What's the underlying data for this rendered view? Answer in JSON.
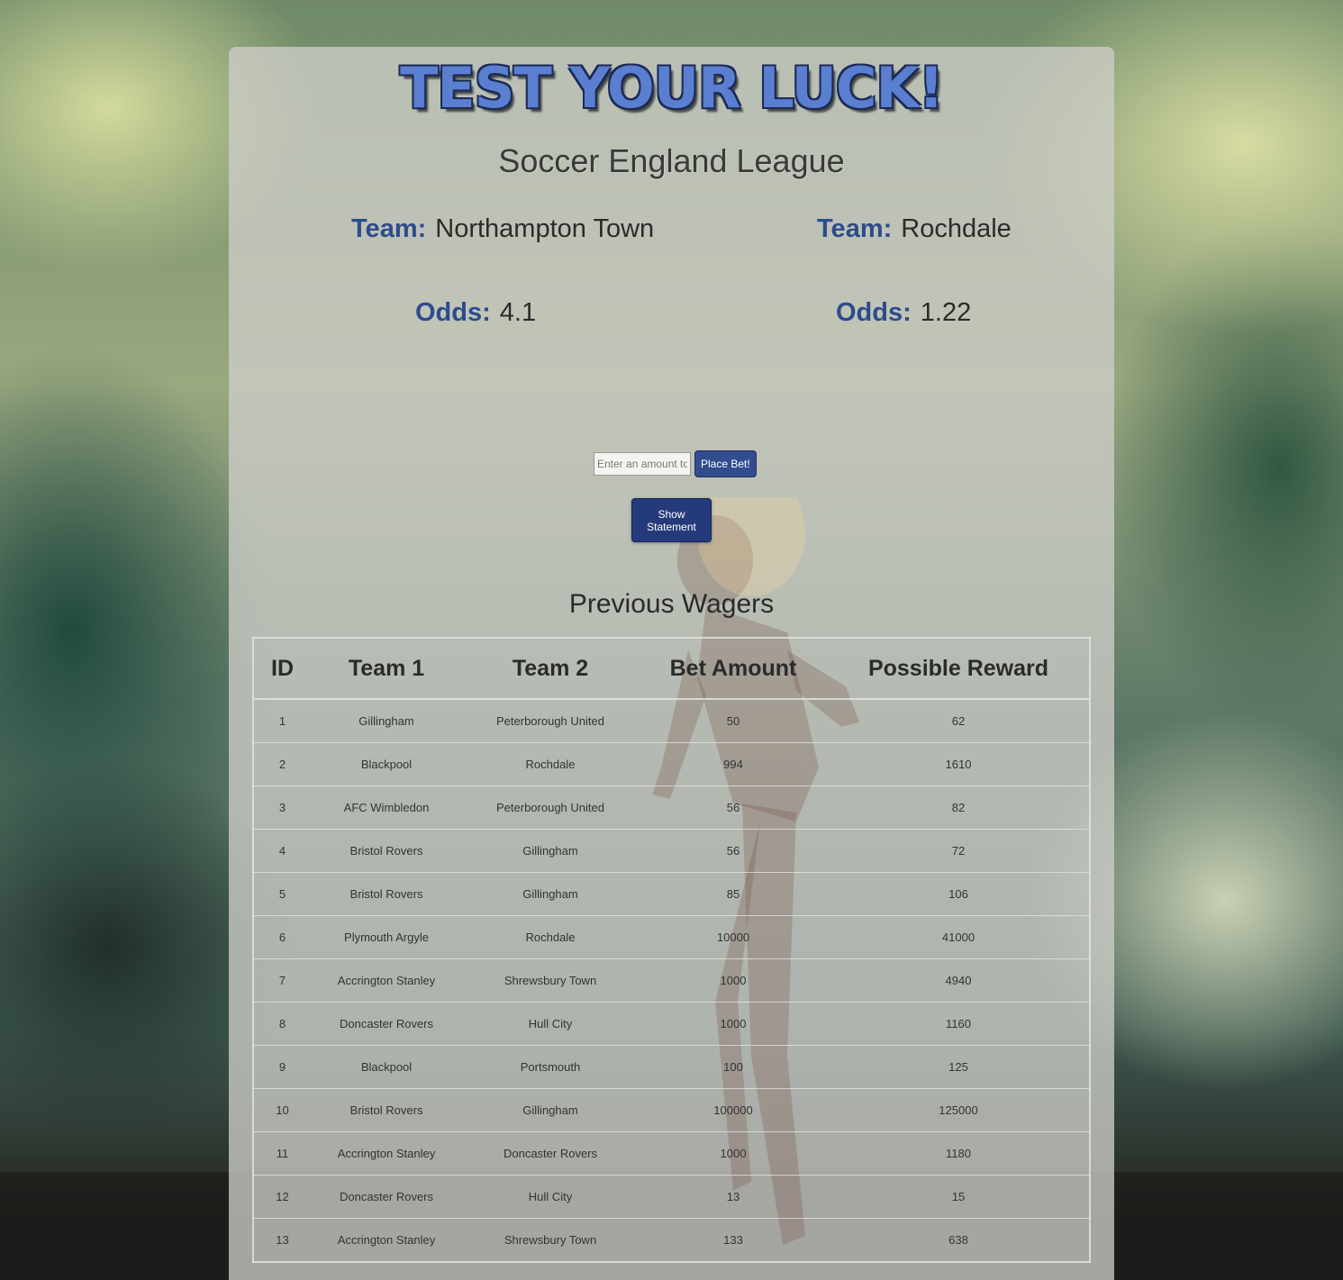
{
  "header": {
    "logo_text": "Test Your Luck!",
    "league_title": "Soccer England League"
  },
  "match": {
    "team_label": "Team:",
    "odds_label": "Odds:",
    "team1": {
      "name": "Northampton Town",
      "odds": "4.1"
    },
    "team2": {
      "name": "Rochdale",
      "odds": "1.22"
    }
  },
  "bet_form": {
    "amount_placeholder": "Enter an amount to place",
    "place_bet_label": "Place Bet!",
    "show_statement_label": "Show Statement"
  },
  "wagers": {
    "title": "Previous Wagers",
    "columns": [
      "ID",
      "Team 1",
      "Team 2",
      "Bet Amount",
      "Possible Reward"
    ],
    "rows": [
      [
        "1",
        "Gillingham",
        "Peterborough United",
        "50",
        "62"
      ],
      [
        "2",
        "Blackpool",
        "Rochdale",
        "994",
        "1610"
      ],
      [
        "3",
        "AFC Wimbledon",
        "Peterborough United",
        "56",
        "82"
      ],
      [
        "4",
        "Bristol Rovers",
        "Gillingham",
        "56",
        "72"
      ],
      [
        "5",
        "Bristol Rovers",
        "Gillingham",
        "85",
        "106"
      ],
      [
        "6",
        "Plymouth Argyle",
        "Rochdale",
        "10000",
        "41000"
      ],
      [
        "7",
        "Accrington Stanley",
        "Shrewsbury Town",
        "1000",
        "4940"
      ],
      [
        "8",
        "Doncaster Rovers",
        "Hull City",
        "1000",
        "1160"
      ],
      [
        "9",
        "Blackpool",
        "Portsmouth",
        "100",
        "125"
      ],
      [
        "10",
        "Bristol Rovers",
        "Gillingham",
        "100000",
        "125000"
      ],
      [
        "11",
        "Accrington Stanley",
        "Doncaster Rovers",
        "1000",
        "1180"
      ],
      [
        "12",
        "Doncaster Rovers",
        "Hull City",
        "13",
        "15"
      ],
      [
        "13",
        "Accrington Stanley",
        "Shrewsbury Town",
        "133",
        "638"
      ]
    ]
  },
  "colors": {
    "accent": "#2e4c8c",
    "logo": "#5b7fd0",
    "button": "#253a7a"
  }
}
